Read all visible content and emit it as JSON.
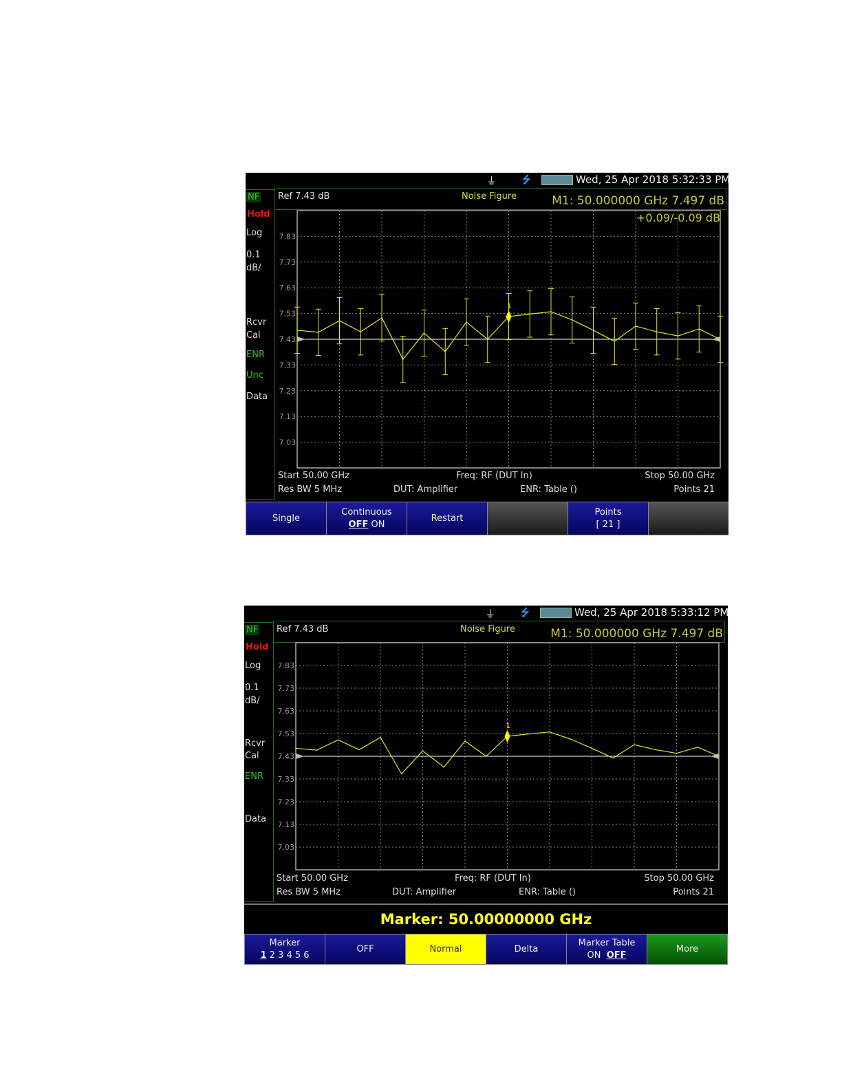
{
  "screens": [
    {
      "status": {
        "datetime": "Wed, 25 Apr 2018 5:32:33 PM",
        "icons": [
          "connector-icon",
          "usb-icon",
          "battery-icon"
        ]
      },
      "mode": "NF",
      "hold": "Hold",
      "scale_type": "Log",
      "scale_value": "0.1",
      "scale_unit": "dB/",
      "side_labels": [
        "Rcvr",
        "Cal",
        "ENR",
        "Unc",
        "Data"
      ],
      "ref": "Ref 7.43 dB",
      "title": "Noise Figure",
      "marker_readout": "M1:  50.000000 GHz   7.497 dB",
      "uncertainty": "+0.09/-0.09 dB",
      "footer": {
        "start": "Start 50.00 GHz",
        "freq": "Freq: RF (DUT In)",
        "stop": "Stop 50.00 GHz",
        "rbw": "Res BW 5 MHz",
        "dut": "DUT: Amplifier",
        "enr": "ENR: Table ()",
        "points": "Points 21"
      },
      "buttons": [
        {
          "l1": "Single"
        },
        {
          "l1": "Continuous",
          "l2a": "OFF",
          "l2b": " ON"
        },
        {
          "l1": "Restart"
        },
        {
          "l1": ""
        },
        {
          "l1": "Points",
          "l2b": "[ 21 ]"
        },
        {
          "l1": ""
        }
      ]
    },
    {
      "status": {
        "datetime": "Wed, 25 Apr 2018 5:33:12 PM",
        "icons": [
          "connector-icon",
          "usb-icon",
          "battery-icon"
        ]
      },
      "mode": "NF",
      "hold": "Hold",
      "scale_type": "Log",
      "scale_value": "0.1",
      "scale_unit": "dB/",
      "side_labels": [
        "Rcvr",
        "Cal",
        "ENR",
        "Data"
      ],
      "ref": "Ref 7.43 dB",
      "title": "Noise Figure",
      "marker_readout": "M1:  50.000000 GHz   7.497 dB",
      "footer": {
        "start": "Start 50.00 GHz",
        "freq": "Freq: RF (DUT In)",
        "stop": "Stop 50.00 GHz",
        "rbw": "Res BW 5 MHz",
        "dut": "DUT: Amplifier",
        "enr": "ENR: Table ()",
        "points": "Points 21"
      },
      "marker_bar": "Marker:  50.00000000 GHz",
      "buttons": [
        {
          "l1": "Marker",
          "l2a": "1",
          "l2b": " 2 3 4 5 6"
        },
        {
          "l1": "OFF"
        },
        {
          "l1": "Normal"
        },
        {
          "l1": "Delta"
        },
        {
          "l1": "Marker Table",
          "l2b": "ON  ",
          "l2c": "OFF"
        },
        {
          "l1": "More"
        }
      ]
    }
  ],
  "chart_data": {
    "type": "line",
    "title": "Noise Figure",
    "ylabel": "dB",
    "y_ticks": [
      "7.83",
      "7.73",
      "7.63",
      "7.53",
      "7.43",
      "7.33",
      "7.23",
      "7.13",
      "7.03"
    ],
    "ylim": [
      6.93,
      7.93
    ],
    "reference": 7.43,
    "points": 21,
    "values": [
      7.465,
      7.457,
      7.502,
      7.459,
      7.513,
      7.352,
      7.454,
      7.382,
      7.497,
      7.43,
      7.518,
      7.528,
      7.537,
      7.505,
      7.465,
      7.422,
      7.481,
      7.459,
      7.443,
      7.47,
      7.43
    ],
    "error_bar": 0.09,
    "marker": {
      "label": "1",
      "index": 10
    },
    "colors": {
      "trace": "#e6e62a",
      "grid": "#888888",
      "ref": "#ffffff"
    }
  }
}
